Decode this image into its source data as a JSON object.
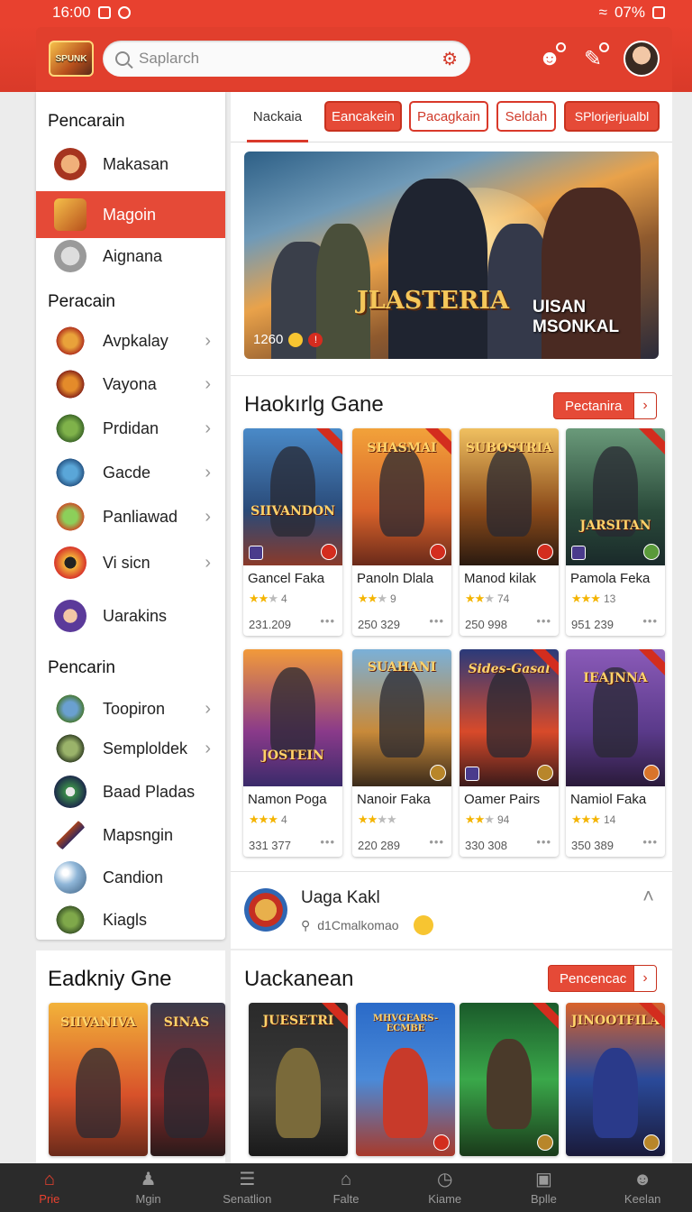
{
  "status_bar": {
    "time": "16:00",
    "battery": "07%"
  },
  "header": {
    "logo_text": "SPUNK",
    "search_placeholder": "Saplarch"
  },
  "sidebar": {
    "section1_title": "Pencarain",
    "section1_items": [
      {
        "label": "Makasan",
        "icon": "user-avatar-icon"
      },
      {
        "label": "Magoin",
        "icon": "logo-icon",
        "active": true
      },
      {
        "label": "Aignana",
        "icon": "user-avatar-icon"
      }
    ],
    "section2_title": "Peracain",
    "section2_items": [
      {
        "label": "Avpkalay",
        "icon": "warrior-icon"
      },
      {
        "label": "Vayona",
        "icon": "warrior-icon"
      },
      {
        "label": "Prdidan",
        "icon": "soldier-icon"
      },
      {
        "label": "Gacde",
        "icon": "gun-icon"
      },
      {
        "label": "Panliawad",
        "icon": "soldier-icon"
      },
      {
        "label": "Vi sicn",
        "icon": "eye-icon"
      },
      {
        "label": "Uarakins",
        "icon": "wizard-icon"
      }
    ],
    "section3_title": "Pencarin",
    "section3_items": [
      {
        "label": "Toopiron",
        "icon": "soldier-icon"
      },
      {
        "label": "Semploldek",
        "icon": "tank-icon"
      },
      {
        "label": "Baad Pladas",
        "icon": "ball-icon"
      },
      {
        "label": "Mapsngin",
        "icon": "rifle-icon"
      },
      {
        "label": "Candion",
        "icon": "orb-icon"
      },
      {
        "label": "Kiagls",
        "icon": "soldier-icon"
      }
    ]
  },
  "tabs": [
    "Nackaia",
    "Eancakein",
    "Pacagkain",
    "Seldah",
    "SPlorjerjualbl"
  ],
  "hero": {
    "title_left": "JLASTERIA",
    "title_right": "UISAN MSONKAL",
    "stat": "1260"
  },
  "section_trending": {
    "title": "Haokırlg Gane",
    "button": "Pectanira",
    "cards": [
      {
        "art_title": "SIIVANDON",
        "name": "Gancel Faka",
        "rating": "4",
        "stars": 2,
        "downloads": "231.209"
      },
      {
        "art_title": "SHASMAI",
        "name": "Panoln Dlala",
        "rating": "9",
        "stars": 2,
        "downloads": "250 329"
      },
      {
        "art_title": "SUBOSTRIA",
        "name": "Manod kilak",
        "rating": "74",
        "stars": 2,
        "downloads": "250 998"
      },
      {
        "art_title": "JARSITAN",
        "name": "Pamola Feka",
        "rating": "13",
        "stars": 3,
        "downloads": "951 239"
      },
      {
        "art_title": "JOSTEIN",
        "name": "Namon Poga",
        "rating": "4",
        "stars": 3,
        "downloads": "331 377"
      },
      {
        "art_title": "SUAHANI",
        "name": "Nanoir Faka",
        "rating": "",
        "stars": 2,
        "downloads": "220 289"
      },
      {
        "art_title": "Sides-Gasal",
        "name": "Oamer Pairs",
        "rating": "94",
        "stars": 2,
        "downloads": "330 308"
      },
      {
        "art_title": "IEAJNNA",
        "name": "Namiol Faka",
        "rating": "14",
        "stars": 3,
        "downloads": "350 389"
      }
    ]
  },
  "notice": {
    "title": "Uaga Kakl",
    "subtitle": "d1Cmalkomao"
  },
  "section_featured_left": {
    "title": "Eadkniy Gne",
    "cards": [
      {
        "art_title": "SIIVANIVA"
      },
      {
        "art_title": "SINAS"
      }
    ]
  },
  "section_upcoming": {
    "title": "Uackanean",
    "button": "Pencencac",
    "cards": [
      {
        "art_title": "JUESETRI"
      },
      {
        "art_title": "MHVGEARS-ECMBE"
      },
      {
        "art_title": ""
      },
      {
        "art_title": "JINOOTFILA"
      }
    ]
  },
  "bottom_nav": [
    {
      "label": "Prie",
      "icon": "home-icon",
      "active": true
    },
    {
      "label": "Mgin",
      "icon": "person-icon"
    },
    {
      "label": "Senatlion",
      "icon": "list-icon"
    },
    {
      "label": "Falte",
      "icon": "house-icon"
    },
    {
      "label": "Kiame",
      "icon": "clock-icon"
    },
    {
      "label": "Bplle",
      "icon": "bag-icon"
    },
    {
      "label": "Keelan",
      "icon": "user-icon"
    }
  ],
  "colors": {
    "accent": "#e8412f",
    "nav_bg": "#2b2b2b"
  }
}
